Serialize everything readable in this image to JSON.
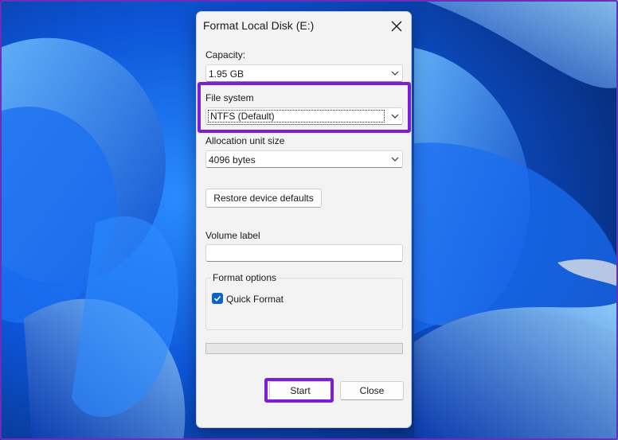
{
  "dialog": {
    "title": "Format Local Disk (E:)",
    "close_icon": "close-icon",
    "capacity": {
      "label": "Capacity:",
      "value": "1.95 GB"
    },
    "file_system": {
      "label": "File system",
      "value": "NTFS (Default)"
    },
    "allocation": {
      "label": "Allocation unit size",
      "value": "4096 bytes"
    },
    "restore_button": "Restore device defaults",
    "volume_label": {
      "label": "Volume label",
      "value": ""
    },
    "format_options": {
      "title": "Format options",
      "quick_format": {
        "label": "Quick Format",
        "checked": true
      }
    },
    "progress": 0,
    "start_button": "Start",
    "close_button": "Close"
  },
  "colors": {
    "highlight": "#7a1fd6",
    "checkbox": "#0a63c9",
    "wallpaper": "#0a3fa6"
  }
}
